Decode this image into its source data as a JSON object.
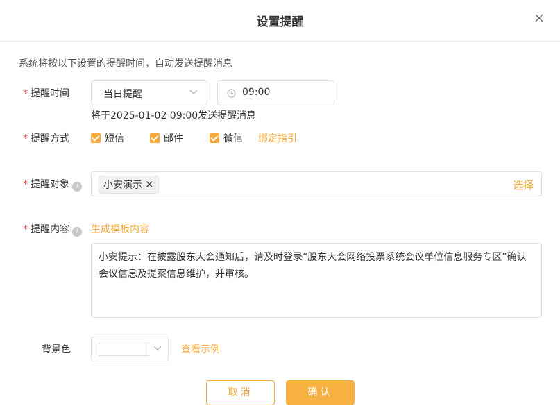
{
  "dialog": {
    "title": "设置提醒",
    "description": "系统将按以下设置的提醒时间，自动发送提醒消息"
  },
  "remind_time": {
    "label": "提醒时间",
    "day_select": "当日提醒",
    "time_value": "09:00",
    "hint": "将于2025-01-02 09:00发送提醒消息"
  },
  "remind_method": {
    "label": "提醒方式",
    "options": [
      {
        "label": "短信",
        "checked": true
      },
      {
        "label": "邮件",
        "checked": true
      },
      {
        "label": "微信",
        "checked": true
      }
    ],
    "bind_guide": "绑定指引"
  },
  "remind_target": {
    "label": "提醒对象",
    "tags": [
      "小安演示"
    ],
    "choose": "选择"
  },
  "remind_content": {
    "label": "提醒内容",
    "generate_template": "生成模板内容",
    "text": "小安提示：在披露股东大会通知后，请及时登录“股东大会网络投票系统会议单位信息服务专区”确认会议信息及提案信息维护，并审核。"
  },
  "background": {
    "label": "背景色",
    "view_example": "查看示例"
  },
  "buttons": {
    "cancel": "取消",
    "confirm": "确认"
  },
  "colors": {
    "accent": "#f5a93a",
    "required": "#e5484d",
    "border": "#dcdfe6"
  }
}
